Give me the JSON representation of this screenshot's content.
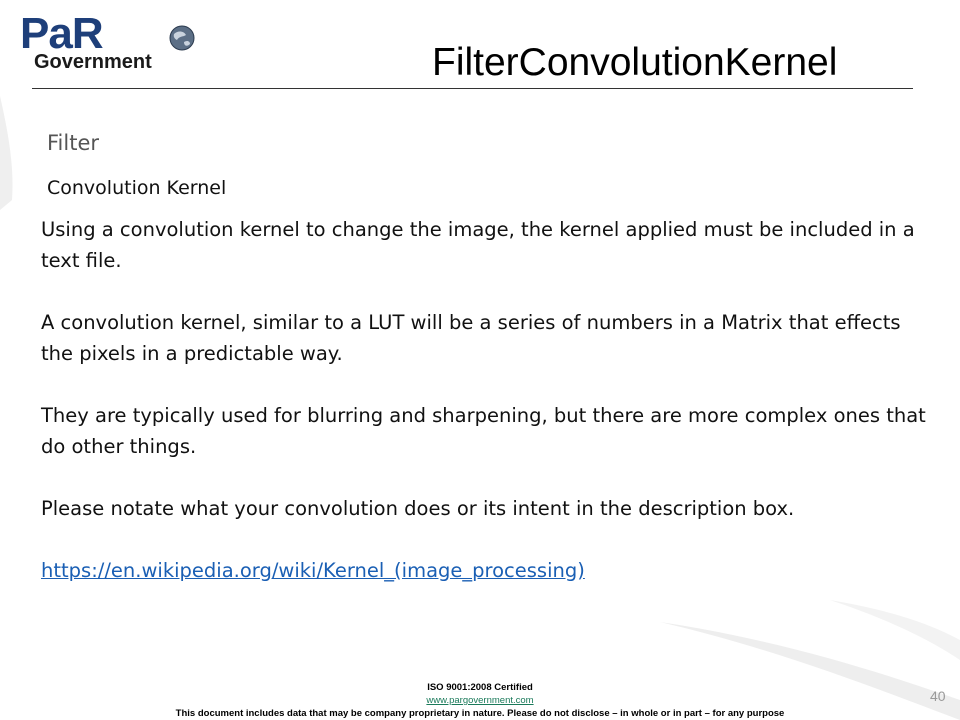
{
  "logo": {
    "wordmark": "PaR",
    "subtitle": "Government",
    "icon": "globe-icon"
  },
  "title": "FilterConvolutionKernel",
  "filter_label": "Filter",
  "kernel_label": "Convolution Kernel",
  "paragraphs": [
    "Using a convolution kernel to change the image, the kernel applied must  be included in a text file.",
    "A convolution kernel, similar to a LUT will be a series of numbers in a Matrix that effects the pixels in a predictable way.",
    "They are typically used for blurring and sharpening, but there are more complex ones that do other things.",
    "Please notate what your convolution does or its intent in the description box."
  ],
  "link": {
    "text": "https://en.wikipedia.org/wiki/Kernel_(image_processing)"
  },
  "footer": {
    "iso": "ISO 9001:2008 Certified",
    "website": "www.pargovernment.com",
    "disclaimer": "This document includes data that may be company proprietary in nature. Please do not disclose – in whole or in part – for any purpose"
  },
  "page_number": "40",
  "colors": {
    "brand_blue": "#1e3f7a",
    "link_blue": "#1a5fb4",
    "footer_link": "#1a7a5a",
    "swoosh": "#eeeeee"
  }
}
